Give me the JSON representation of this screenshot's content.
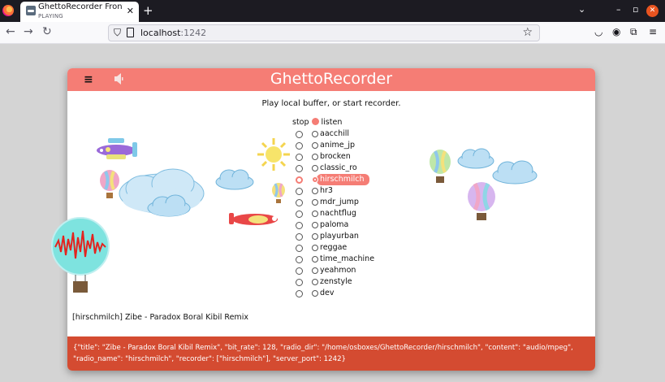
{
  "browser": {
    "tab_title": "GhettoRecorder Frontend",
    "tab_subtitle": "PLAYING",
    "url_host": "localhost",
    "url_port": ":1242"
  },
  "app": {
    "title": "GhettoRecorder",
    "subtitle": "Play local buffer, or start recorder.",
    "list_header_stop": "stop",
    "list_header_listen": "listen",
    "stations": [
      "aacchill",
      "anime_jp",
      "brocken",
      "classic_ro",
      "hirschmilch",
      "hr3",
      "mdr_jump",
      "nachtflug",
      "paloma",
      "playurban",
      "reggae",
      "time_machine",
      "yeahmon",
      "zenstyle",
      "dev"
    ],
    "active_station": "hirschmilch",
    "now_playing": "[hirschmilch] Zibe - Paradox Boral Kibil Remix",
    "info_line1": "{\"title\": \"Zibe - Paradox Boral Kibil Remix\", \"bit_rate\": 128, \"radio_dir\": \"/home/osboxes/GhettoRecorder/hirschmilch\", \"content\": \"audio/mpeg\",",
    "info_line2": "\"radio_name\": \"hirschmilch\", \"recorder\": [\"hirschmilch\"], \"server_port\": 1242}"
  },
  "colors": {
    "accent": "#f57d75",
    "info_bar": "#d44b31"
  }
}
